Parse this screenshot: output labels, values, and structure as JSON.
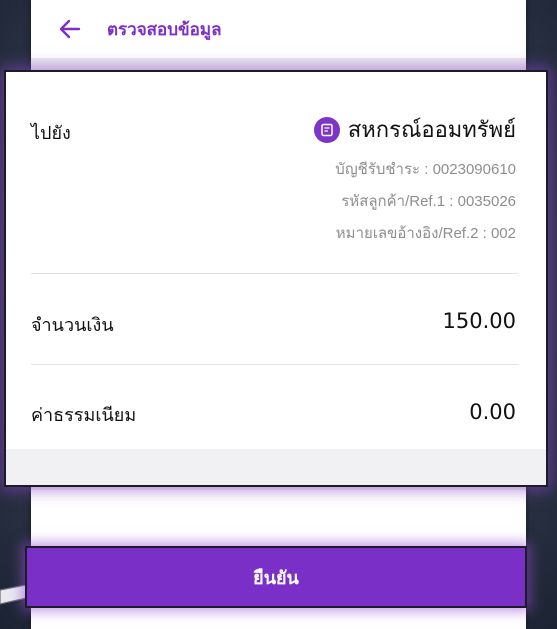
{
  "header": {
    "title": "ตรวจสอบข้อมูล",
    "back_icon": "arrow-left-icon"
  },
  "card": {
    "to_label": "ไปยัง",
    "biller": {
      "icon": "biller-logo-icon",
      "name": "สหกรณ์ออมทรัพย์"
    },
    "details": [
      "บัญชีรับชำระ : 0023090610",
      "รหัสลูกค้า/Ref.1 : 0035026",
      "หมายเลขอ้างอิง/Ref.2 : 002"
    ],
    "amount_label": "จำนวนเงิน",
    "amount_value": "150.00",
    "fee_label": "ค่าธรรมเนียม",
    "fee_value": "0.00"
  },
  "confirm_button": {
    "label": "ยืนยัน"
  },
  "colors": {
    "accent": "#7a2fc7",
    "glow": "#a060dc"
  }
}
